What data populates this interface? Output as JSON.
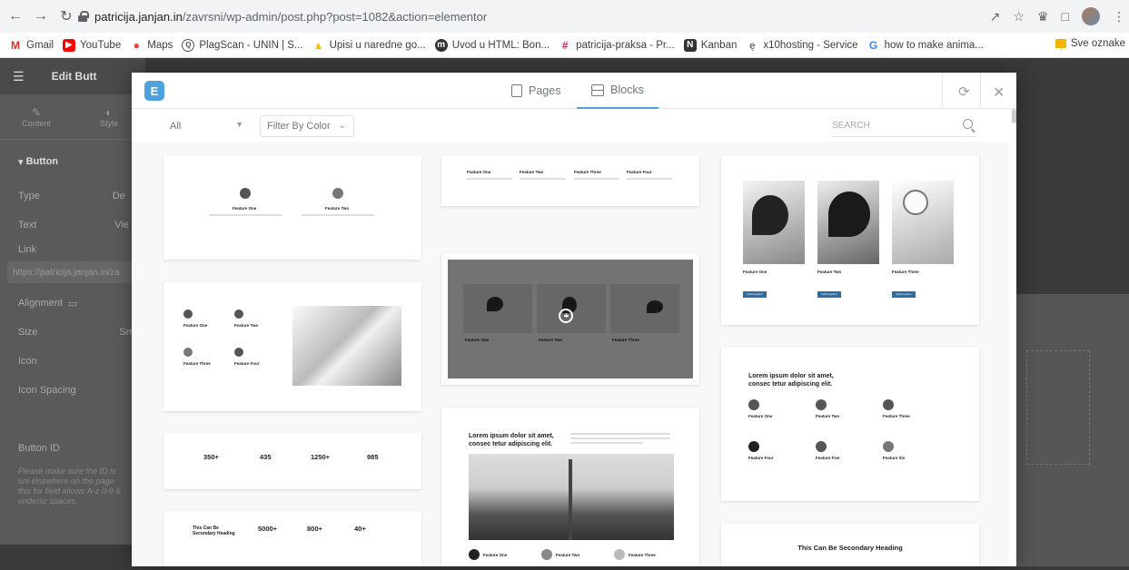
{
  "browser": {
    "url_host": "patricija.janjan.in",
    "url_path": "/zavrsni/wp-admin/post.php?post=1082&action=elementor",
    "bookmarks": [
      "Gmail",
      "YouTube",
      "Maps",
      "PlagScan - UNIN | S...",
      "Upisi u naredne go...",
      "Uvod u HTML: Bon...",
      "patricija-praksa - Pr...",
      "Kanban",
      "x10hosting - Service",
      "how to make anima..."
    ],
    "other_bookmarks": "Sve oznake"
  },
  "editor": {
    "title": "Edit Butt",
    "tabs": [
      "Content",
      "Style"
    ],
    "section": "Button",
    "fields": [
      "Type",
      "Text",
      "Link",
      "Alignment",
      "Size",
      "Icon",
      "Icon Spacing",
      "Button ID"
    ],
    "field_values": {
      "type": "De",
      "text": "Vie",
      "size": "Sm"
    },
    "link_value": "https://patricija.janjan.in/za",
    "note": "Please make sure the ID is uni elsewhere on the page this for field allows A-z 0-9 & undersc spaces."
  },
  "modal": {
    "tabs": {
      "pages": "Pages",
      "blocks": "Blocks"
    },
    "filter_all": "All",
    "filter_color": "Filter By Color",
    "search_placeholder": "SEARCH"
  },
  "blocks": {
    "feature_one": "Feature One",
    "feature_two": "Feature Two",
    "feature_three": "Feature Three",
    "feature_four": "Feature Four",
    "feature_five": "Feature Five",
    "feature_six": "Feature Six",
    "stats": [
      "350+",
      "435",
      "1250+",
      "985"
    ],
    "stats2": [
      "5000+",
      "800+",
      "40+"
    ],
    "secondary_heading": "This Can Be Secondary Heading",
    "lorem_heading": "Lorem ipsum dolor sit amet, consec tetur adipiscing elit.",
    "lorem_heading_l1": "Lorem ipsum dolor sit amet,",
    "lorem_heading_l2": "consec tetur adipiscing elit.",
    "btn_label": "Call to action"
  }
}
